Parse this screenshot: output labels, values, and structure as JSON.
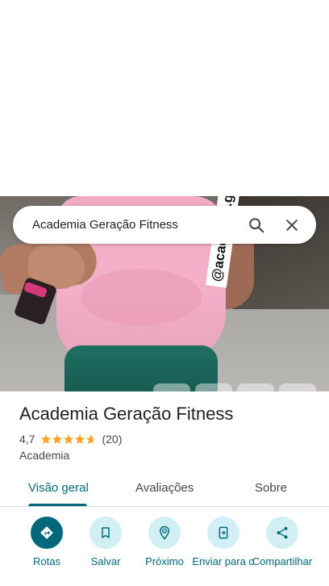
{
  "search": {
    "query": "Academia Geração Fitness"
  },
  "photo": {
    "watermark": "@academia.geracao.fitness"
  },
  "place": {
    "name": "Academia Geração Fitness",
    "rating": "4,7",
    "stars": 4.7,
    "reviews": "(20)",
    "category": "Academia"
  },
  "tabs": [
    {
      "label": "Visão geral",
      "active": true
    },
    {
      "label": "Avaliações",
      "active": false
    },
    {
      "label": "Sobre",
      "active": false
    }
  ],
  "actions": [
    {
      "label": "Rotas",
      "icon": "directions-icon"
    },
    {
      "label": "Salvar",
      "icon": "bookmark-icon"
    },
    {
      "label": "Próximo",
      "icon": "nearby-icon"
    },
    {
      "label": "Enviar para o",
      "icon": "send-to-phone-icon"
    },
    {
      "label": "Compartilhar",
      "icon": "share-icon"
    }
  ],
  "colors": {
    "accent": "#00687a",
    "action_bg": "#d3eff6",
    "star": "#f6a623"
  }
}
